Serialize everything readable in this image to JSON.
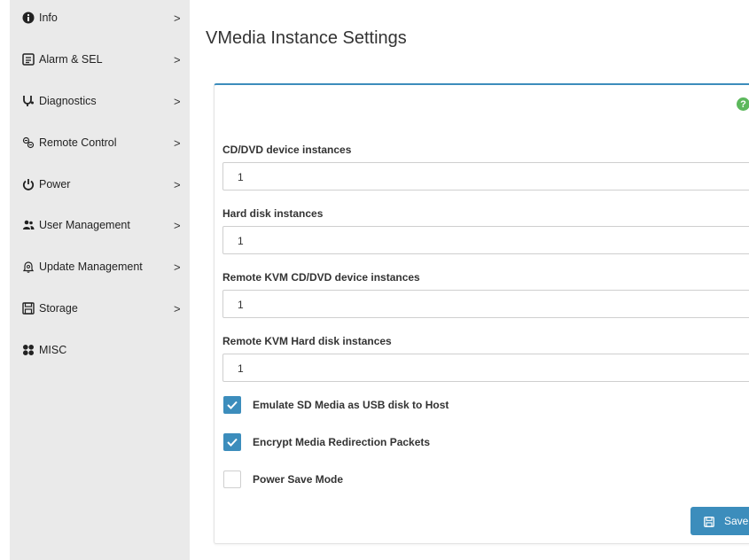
{
  "sidebar": {
    "items": [
      {
        "label": "Info",
        "icon": "info-circle-icon",
        "chevron": ">"
      },
      {
        "label": "Alarm & SEL",
        "icon": "alarm-log-icon",
        "chevron": ">"
      },
      {
        "label": "Diagnostics",
        "icon": "stethoscope-icon",
        "chevron": ">"
      },
      {
        "label": "Remote Control",
        "icon": "remote-control-icon",
        "chevron": ">"
      },
      {
        "label": "Power",
        "icon": "power-icon",
        "chevron": ">"
      },
      {
        "label": "User Management",
        "icon": "users-icon",
        "chevron": ">"
      },
      {
        "label": "Update Management",
        "icon": "update-bell-icon",
        "chevron": ">"
      },
      {
        "label": "Storage",
        "icon": "storage-disk-icon",
        "chevron": ">"
      },
      {
        "label": "MISC",
        "icon": "misc-grid-icon"
      }
    ]
  },
  "main": {
    "title": "VMedia Instance Settings",
    "help_icon": "?",
    "fields": [
      {
        "label": "CD/DVD device instances",
        "value": "1"
      },
      {
        "label": "Hard disk instances",
        "value": "1"
      },
      {
        "label": "Remote KVM CD/DVD device instances",
        "value": "1"
      },
      {
        "label": "Remote KVM Hard disk instances",
        "value": "1"
      }
    ],
    "checkboxes": [
      {
        "label": "Emulate SD Media as USB disk to Host",
        "checked": true
      },
      {
        "label": "Encrypt Media Redirection Packets",
        "checked": true
      },
      {
        "label": "Power Save Mode",
        "checked": false
      }
    ],
    "save_label": "Save"
  },
  "colors": {
    "accent": "#3c8dbc",
    "sidebar_bg": "#eaeaea",
    "help_green": "#5cb85c"
  }
}
